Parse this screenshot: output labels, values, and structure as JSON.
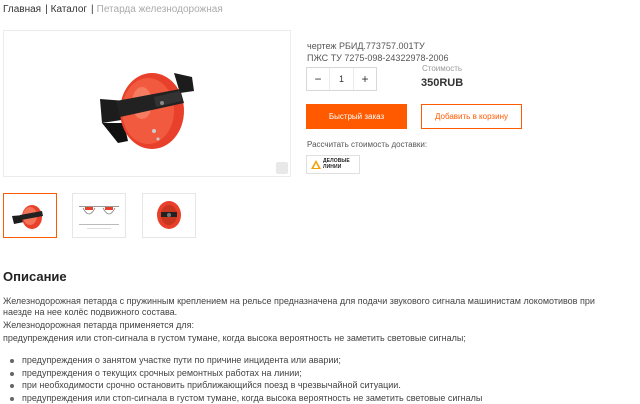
{
  "breadcrumb": {
    "home": "Главная",
    "separator": "|",
    "catalog": "Каталог",
    "current": "Петарда железнодорожная"
  },
  "product": {
    "spec_line_1": "чертеж РБИД.773757.001ТУ",
    "spec_line_2": "ПЖС ТУ 7275-098-24322978-2006",
    "quantity": {
      "minus": "−",
      "value": "1",
      "plus": "+"
    },
    "price_label": "Стоимость",
    "price": "350RUB",
    "quick_order_label": "Быстрый заказ",
    "add_to_cart_label": "Добавить в корзину",
    "delivery_label": "Рассчитать стоимость доставки:",
    "delivery_logo_line_1": "ДЕЛОВЫЕ",
    "delivery_logo_line_2": "ЛИНИИ",
    "images": [
      "photo-front",
      "schematic",
      "photo-side"
    ]
  },
  "description": {
    "title": "Описание",
    "line_1": "Железнодорожная петарда с пружинным креплением на рельсе предназначена для подачи звукового сигнала машинистам локомотивов при",
    "line_2": "наезде на нее колёс подвижного состава.",
    "line_3": "Железнодорожная петарда применяется для:",
    "line_4": "предупреждения или стоп-сигнала в густом тумане, когда высока вероятность не заметить световые сигналы;",
    "bullets": [
      "предупреждения о занятом участке пути по причине инцидента или аварии;",
      "предупреждения о текущих срочных ремонтных работах на линии;",
      "при необходимости срочно остановить приближающийся поезд в чрезвычайной ситуации.",
      "предупреждения или стоп-сигнала в густом тумане, когда высока вероятность не заметить световые сигналы"
    ]
  },
  "colors": {
    "accent": "#ff5a00",
    "petard_red": "#e8402a"
  }
}
